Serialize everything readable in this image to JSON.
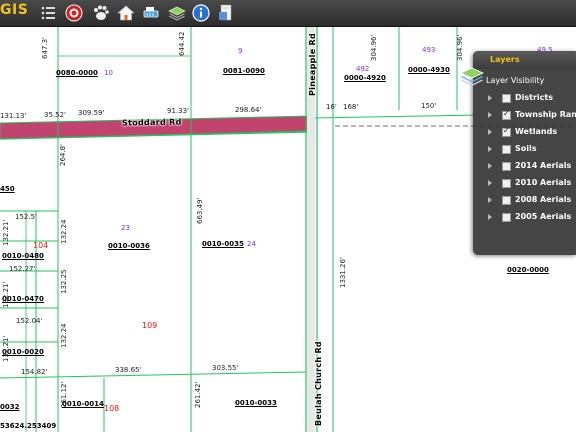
{
  "app": {
    "title": "GIS"
  },
  "toolbar": {
    "tools": [
      {
        "name": "list-icon"
      },
      {
        "name": "target-icon"
      },
      {
        "name": "paw-icon"
      },
      {
        "name": "home-icon"
      },
      {
        "name": "measure-icon"
      },
      {
        "name": "layers-stack-icon"
      },
      {
        "name": "info-icon"
      },
      {
        "name": "print-icon"
      }
    ]
  },
  "colors": {
    "parcel_line": "#22c55e",
    "road_fill": "#c2446e",
    "toolbar_bg": "#333333",
    "accent": "#f0c419"
  },
  "layers": {
    "title": "Layers",
    "visibility_heading": "Layer Visibility",
    "items": [
      {
        "label": "Districts",
        "checked": false
      },
      {
        "label": "Township Range",
        "checked": true
      },
      {
        "label": "Wetlands",
        "checked": true
      },
      {
        "label": "Soils",
        "checked": false
      },
      {
        "label": "2014 Aerials",
        "checked": false
      },
      {
        "label": "2010 Aerials",
        "checked": false
      },
      {
        "label": "2008 Aerials",
        "checked": false
      },
      {
        "label": "2005 Aerials",
        "checked": false
      }
    ]
  },
  "map": {
    "roads": {
      "stoddard": "Stoddard Rd",
      "pineapple": "Pineapple Rd",
      "beulah_church": "Beulah Church Rd"
    },
    "parcels": {
      "p1": "0080-0000",
      "p2": "0081-0090",
      "p3": "0000-4920",
      "p4": "0000-4930",
      "p5": "0010-0036",
      "p6": "0010-0035",
      "p7": "0010-0480",
      "p8": "0010-0470",
      "p9": "0010-0020",
      "p10": "0010-0014",
      "p11": "0010-0033",
      "p12": "0020-0000",
      "p13": "0032",
      "p14": "450",
      "p15": "53624.253409"
    },
    "dims": {
      "d1": "647.3'",
      "d2": "644.42",
      "d3": "304.96'",
      "d4": "304.96'",
      "d5": "131.13'",
      "d6": "35.52'",
      "d7": "309.59'",
      "d8": "91.33'",
      "d9": "298.64'",
      "d10": "16'",
      "d11": "168'",
      "d12": "150'",
      "d13": "264.8'",
      "d14": "663.49'",
      "d15": "1331.26'",
      "d16": "152.5'",
      "d17": "132.24",
      "d18": "132.21'",
      "d19": "152.27'",
      "d20": "132.25",
      "d21": "132.21'",
      "d22": "152.04'",
      "d23": "132.24",
      "d24": "132.21'",
      "d25": "154.82'",
      "d26": "338.65'",
      "d27": "303.55'",
      "d28": "261.12'",
      "d29": "261.42'"
    },
    "acres": {
      "a1": "10",
      "a2": "9",
      "a3": "492",
      "a4": "493",
      "a5": "49.5",
      "a6": "23",
      "a7": "24"
    },
    "lots": {
      "l1": "104",
      "l2": "109",
      "l3": "108"
    }
  }
}
